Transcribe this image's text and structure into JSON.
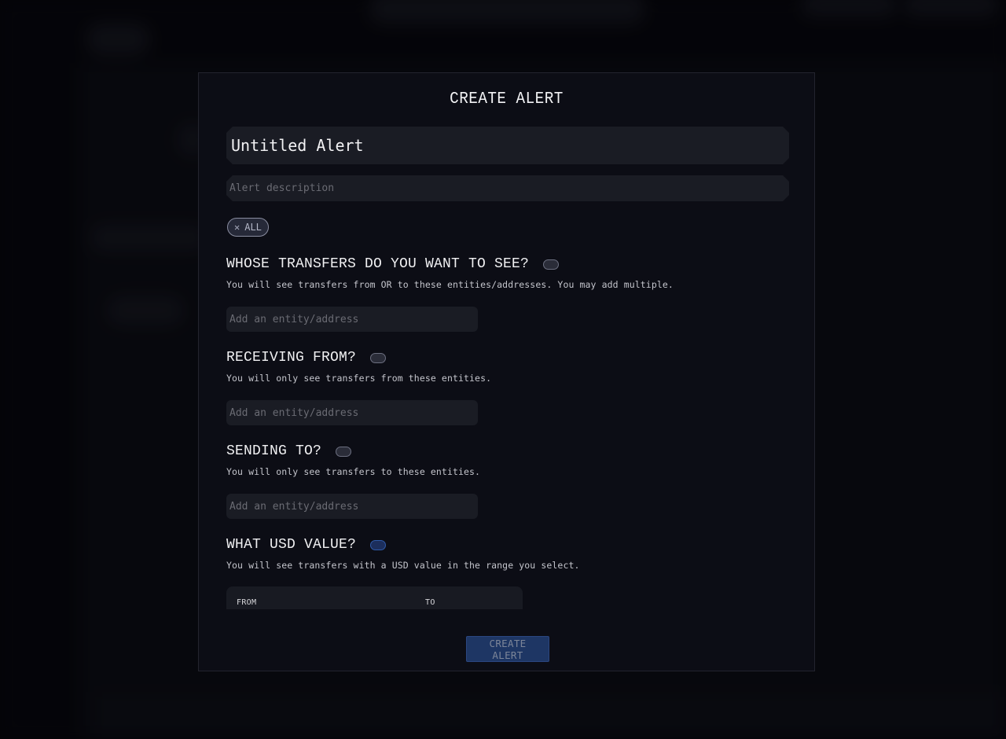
{
  "modal": {
    "title": "CREATE ALERT",
    "name_value": "Untitled Alert",
    "description_placeholder": "Alert description",
    "chip": {
      "icon": "close-icon",
      "label": "ALL"
    },
    "sections": [
      {
        "title": "WHOSE TRANSFERS DO YOU WANT TO SEE?",
        "toggle_on": false,
        "subtitle": "You will see transfers from OR to these entities/addresses. You may add multiple.",
        "input_placeholder": "Add an entity/address"
      },
      {
        "title": "RECEIVING FROM?",
        "toggle_on": false,
        "subtitle": "You will only see transfers from these entities.",
        "input_placeholder": "Add an entity/address"
      },
      {
        "title": "SENDING TO?",
        "toggle_on": false,
        "subtitle": "You will only see transfers to these entities.",
        "input_placeholder": "Add an entity/address"
      },
      {
        "title": "WHAT USD VALUE?",
        "toggle_on": true,
        "subtitle": "You will see transfers with a USD value in the range you select.",
        "range": {
          "from_label": "FROM",
          "to_label": "TO"
        }
      }
    ],
    "submit_label": "CREATE ALERT"
  },
  "colors": {
    "accent": "#1e3664",
    "toggle_active": "#2f5aa8",
    "modal_bg": "#0c0d15",
    "input_bg": "#1a1c24"
  }
}
